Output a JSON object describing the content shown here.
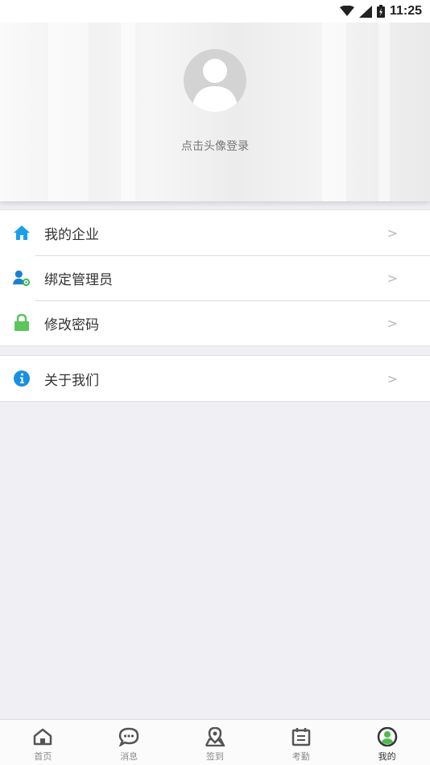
{
  "status_bar": {
    "time": "11:25"
  },
  "profile": {
    "login_hint": "点击头像登录"
  },
  "menu": {
    "group1": [
      {
        "label": "我的企业",
        "icon": "home-icon",
        "color": "#1aa0e8"
      },
      {
        "label": "绑定管理员",
        "icon": "user-gear-icon",
        "color": "#1a7fd4"
      },
      {
        "label": "修改密码",
        "icon": "lock-icon",
        "color": "#5cc55c"
      }
    ],
    "group2": [
      {
        "label": "关于我们",
        "icon": "info-icon",
        "color": "#1a8fe0"
      }
    ],
    "arrow": ">"
  },
  "tabs": [
    {
      "label": "首页",
      "icon": "home-outline-icon"
    },
    {
      "label": "消息",
      "icon": "chat-icon"
    },
    {
      "label": "签到",
      "icon": "location-icon"
    },
    {
      "label": "考勤",
      "icon": "calendar-icon"
    },
    {
      "label": "我的",
      "icon": "profile-icon",
      "active": true
    }
  ]
}
